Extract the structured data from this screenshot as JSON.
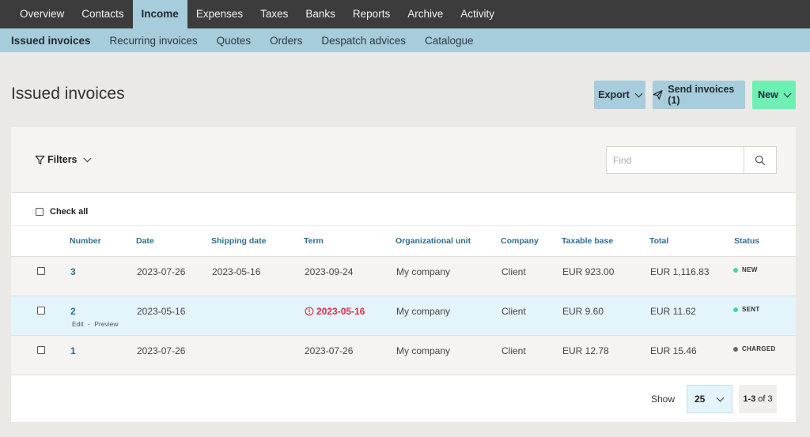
{
  "top_nav": [
    {
      "label": "Overview",
      "active": false
    },
    {
      "label": "Contacts",
      "active": false
    },
    {
      "label": "Income",
      "active": true
    },
    {
      "label": "Expenses",
      "active": false
    },
    {
      "label": "Taxes",
      "active": false
    },
    {
      "label": "Banks",
      "active": false
    },
    {
      "label": "Reports",
      "active": false
    },
    {
      "label": "Archive",
      "active": false
    },
    {
      "label": "Activity",
      "active": false
    }
  ],
  "sub_nav": [
    {
      "label": "Issued invoices",
      "active": true
    },
    {
      "label": "Recurring invoices",
      "active": false
    },
    {
      "label": "Quotes",
      "active": false
    },
    {
      "label": "Orders",
      "active": false
    },
    {
      "label": "Despatch advices",
      "active": false
    },
    {
      "label": "Catalogue",
      "active": false
    }
  ],
  "page": {
    "title": "Issued invoices"
  },
  "actions": {
    "export_label": "Export",
    "send_label": "Send invoices (1)",
    "new_label": "New"
  },
  "toolbar": {
    "filters_label": "Filters",
    "search_placeholder": "Find",
    "check_all_label": "Check all"
  },
  "table": {
    "headers": {
      "number": "Number",
      "date": "Date",
      "shipping_date": "Shipping date",
      "term": "Term",
      "org_unit": "Organizational unit",
      "company": "Company",
      "taxable_base": "Taxable base",
      "total": "Total",
      "status": "Status"
    },
    "rows": [
      {
        "number": "3",
        "date": "2023-07-26",
        "shipping_date": "2023-05-16",
        "term": "2023-09-24",
        "term_overdue": false,
        "org_unit": "My company",
        "company": "Client",
        "taxable_base": "EUR 923.00",
        "total": "EUR 1,116.83",
        "status": "NEW",
        "status_color": "#3ddc97"
      },
      {
        "number": "2",
        "date": "2023-05-16",
        "shipping_date": "",
        "term": "2023-05-16",
        "term_overdue": true,
        "org_unit": "My company",
        "company": "Client",
        "taxable_base": "EUR 9.60",
        "total": "EUR 11.62",
        "status": "SENT",
        "status_color": "#3ddc97",
        "edit_label": "Edit",
        "separator": "-",
        "preview_label": "Preview"
      },
      {
        "number": "1",
        "date": "2023-07-26",
        "shipping_date": "",
        "term": "2023-07-26",
        "term_overdue": false,
        "org_unit": "My company",
        "company": "Client",
        "taxable_base": "EUR 12.78",
        "total": "EUR 15.46",
        "status": "CHARGED",
        "status_color": "#666666"
      }
    ]
  },
  "pagination": {
    "show_label": "Show",
    "per_page": "25",
    "range": "1-3",
    "of_label": "of",
    "total": "3"
  },
  "colors": {
    "accent": "#a7ccdb",
    "primary_action": "#6ef0b5",
    "overdue": "#d93045",
    "link": "#2e6f8e"
  }
}
